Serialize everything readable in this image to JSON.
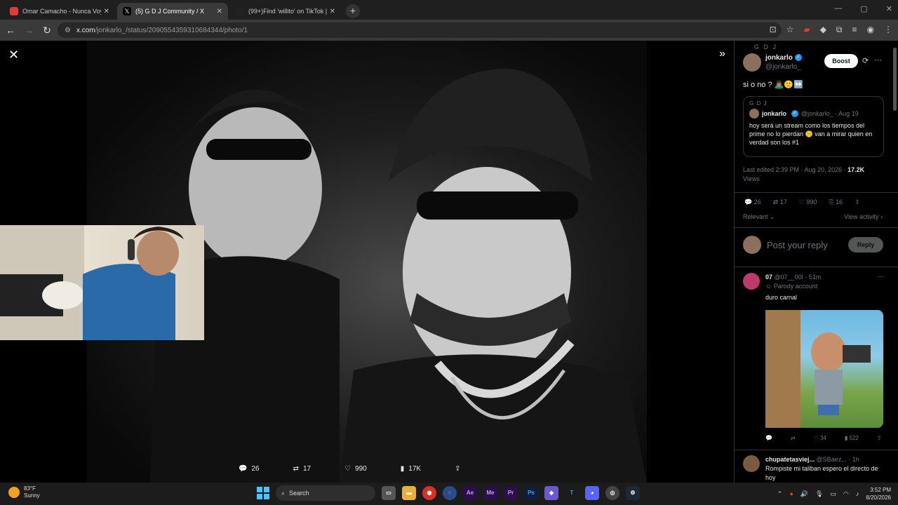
{
  "tabs": [
    {
      "title": "Omar Camacho - Nunca Voy A",
      "fav_color": "#e53935",
      "active": false
    },
    {
      "title": "(5) G D J Community / X",
      "fav_color": "#000000",
      "active": true
    },
    {
      "title": "(99+)Find 'willito' on TikTok | Te",
      "fav_color": "#222222",
      "active": false
    }
  ],
  "browser": {
    "url_host": "x.com",
    "url_path": "/jonkarlo_/status/2090554359310684344/photo/1"
  },
  "photo_actions": {
    "replies": "26",
    "reposts": "17",
    "likes": "990",
    "views": "17K"
  },
  "tweet": {
    "community": "G D J",
    "display_name": "jonkarlo",
    "handle": "@jonkarlo_",
    "boost_label": "Boost",
    "text": "si o no ? 🙇🏽‍♂️🙂↔️",
    "quote": {
      "community": "G D J",
      "display_name": "jonkarlo",
      "handle_date": "@jonkarlo_ · Aug 19",
      "text": "hoy será un stream como los tiempos del prime no lo pierdan 🤫 van a mirar quien en verdad son los #1"
    },
    "edited": "Last edited 2:39 PM · Aug 20, 2026 · ",
    "views_count": "17.2K",
    "views_label": "Views",
    "stats": {
      "replies": "26",
      "reposts": "17",
      "likes": "990",
      "bookmarks": "16"
    },
    "relevant_label": "Relevant",
    "view_activity_label": "View activity"
  },
  "reply_box": {
    "placeholder": "Post your reply",
    "button": "Reply"
  },
  "replies": [
    {
      "display_name": "07",
      "handle_time": "@07__00l · 51m",
      "badge": "Parody account",
      "text": "duro carnal",
      "stats": {
        "reposts": "",
        "likes": "34",
        "views": "522"
      },
      "av_color": "#c0396b"
    },
    {
      "display_name": "chupatetasviej...",
      "handle_time": "@SBaez... · 1h",
      "text": "Rompiste mi taliban espero el directo de hoy",
      "av_color": "#7a5a40"
    }
  ],
  "taskbar": {
    "temp": "83°F",
    "condition": "Sunny",
    "search": "Search",
    "time": "3:52 PM",
    "date": "8/20/2026"
  }
}
